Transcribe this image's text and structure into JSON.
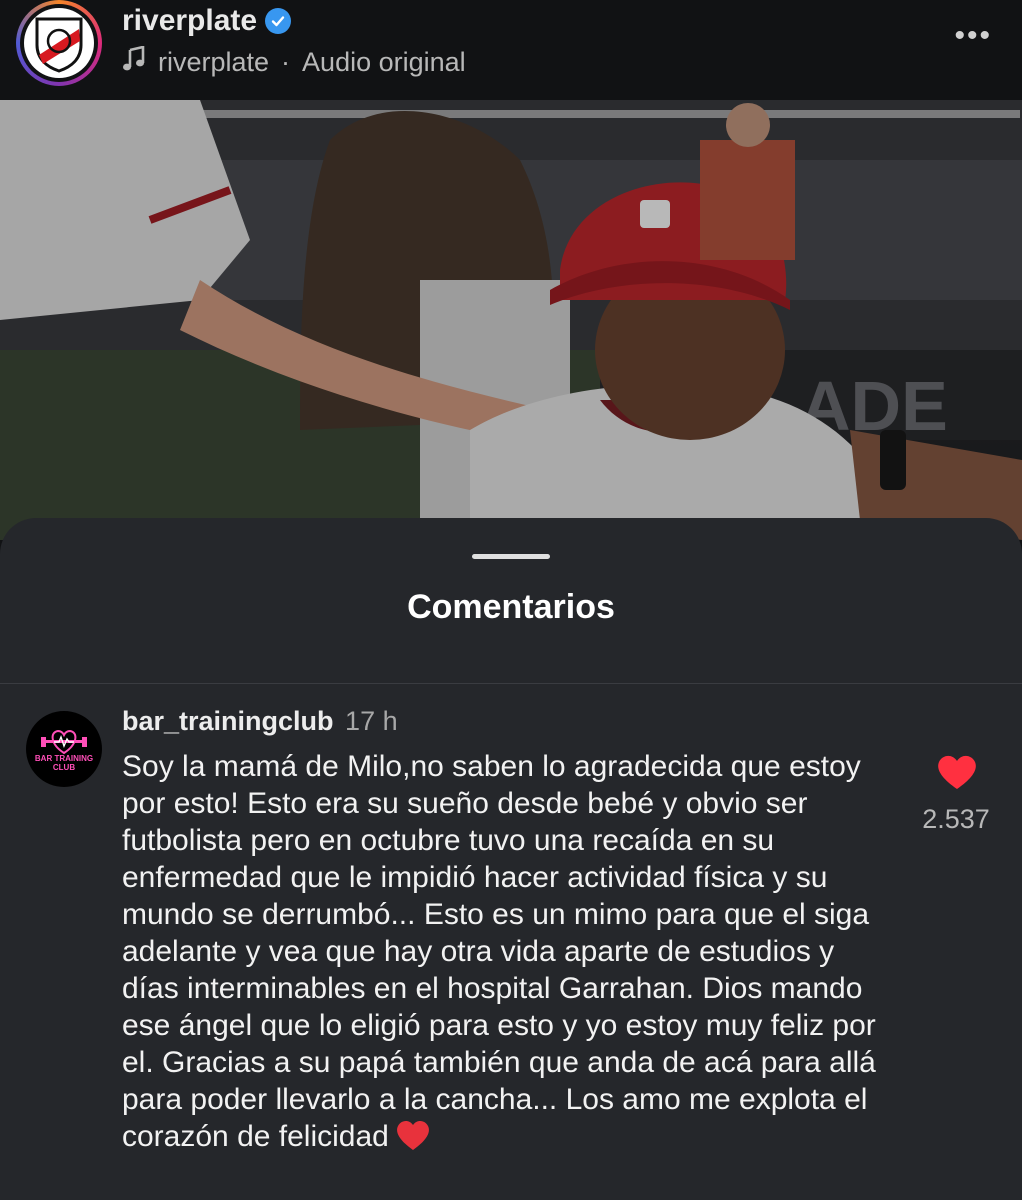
{
  "header": {
    "username": "riverplate",
    "audio_owner": "riverplate",
    "audio_separator": "·",
    "audio_label": "Audio original",
    "more_label": "•••",
    "avatar_monogram": "CARP"
  },
  "sheet": {
    "title": "Comentarios"
  },
  "comment": {
    "username": "bar_trainingclub",
    "time": "17 h",
    "avatar_label": "BAR TRAINING CLUB",
    "text": "Soy la mamá de Milo,no saben lo agradecida que estoy por esto! Esto era su sueño desde bebé y obvio ser futbolista pero en octubre tuvo una recaída en su enfermedad que le impidió hacer actividad física y su mundo se derrumbó... Esto es un mimo para que el siga adelante y vea que hay otra vida aparte de estudios y días interminables en el hospital Garrahan. Dios mando ese ángel que lo eligió para esto y yo estoy muy feliz por el. Gracias a su papá también que anda de acá para allá para poder llevarlo a la cancha... Los amo me explota el corazón de felicidad",
    "likes": "2.537"
  },
  "colors": {
    "background": "#111214",
    "sheet": "#25272b",
    "heart": "#ff3040",
    "verified": "#3897f0"
  }
}
